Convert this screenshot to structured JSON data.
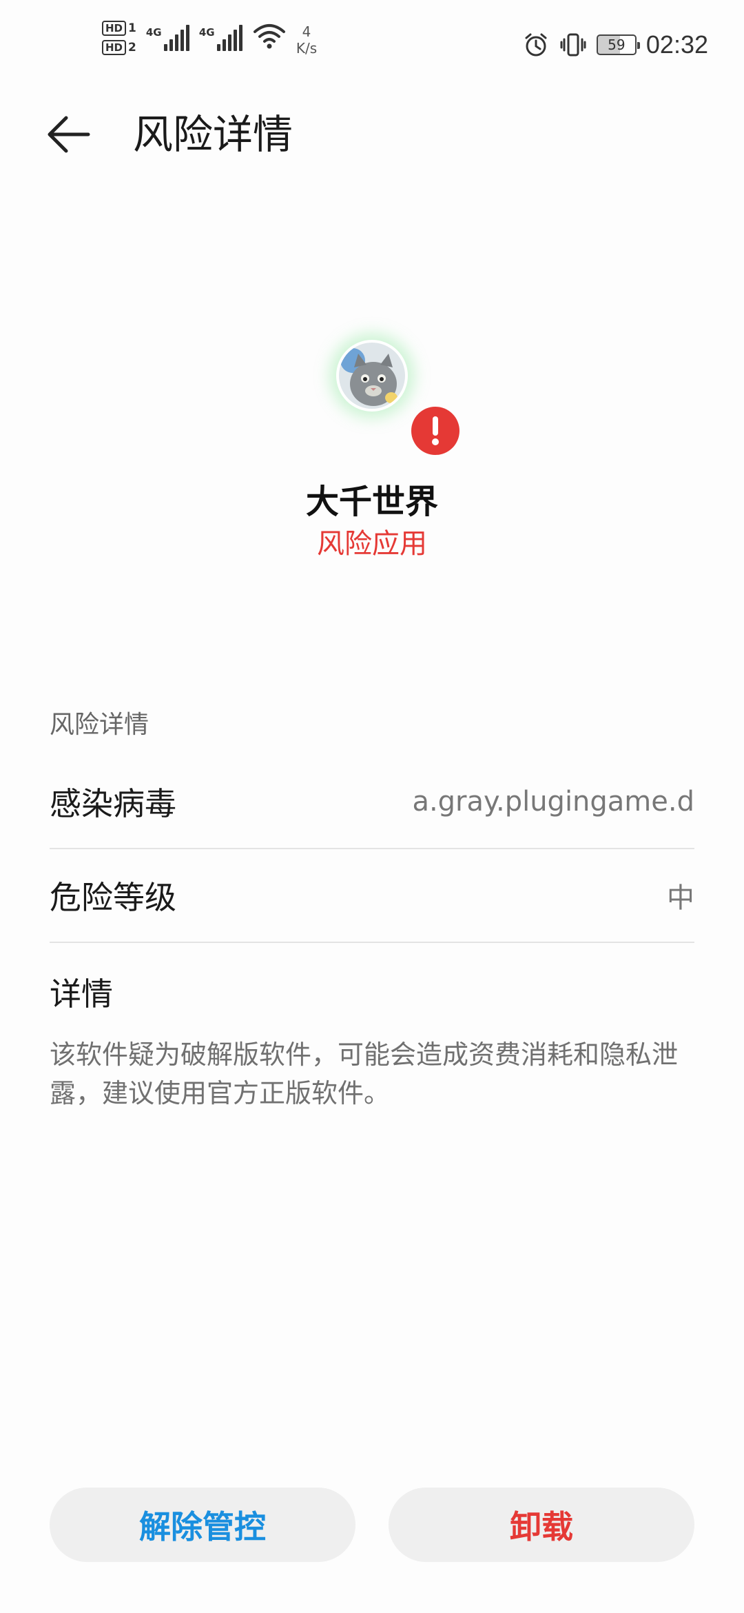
{
  "status_bar": {
    "hd1": "HD",
    "hd1_sub": "1",
    "hd2": "HD",
    "hd2_sub": "2",
    "sim1_type": "4G",
    "sim2_type": "4G",
    "speed_value": "4",
    "speed_unit": "K/s",
    "battery": "59",
    "time": "02:32"
  },
  "header": {
    "title": "风险详情"
  },
  "app": {
    "name": "大千世界",
    "status": "风险应用",
    "status_color": "#e53935"
  },
  "risk_section": {
    "label": "风险详情",
    "rows": [
      {
        "label": "感染病毒",
        "value": "a.gray.plugingame.d"
      },
      {
        "label": "危险等级",
        "value": "中"
      }
    ],
    "detail_title": "详情",
    "detail_text": "该软件疑为破解版软件，可能会造成资费消耗和隐私泄露，建议使用官方正版软件。"
  },
  "actions": {
    "release_label": "解除管控",
    "release_color": "#1a8fdf",
    "uninstall_label": "卸载",
    "uninstall_color": "#e53935"
  }
}
